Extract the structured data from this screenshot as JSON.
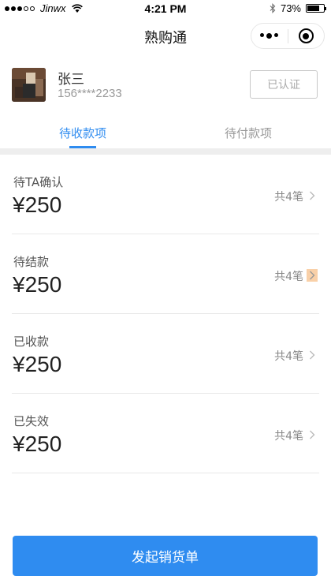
{
  "status_bar": {
    "carrier": "Jinwx",
    "time": "4:21 PM",
    "battery": "73%",
    "battery_level": 0.73
  },
  "nav": {
    "title": "熟购通"
  },
  "profile": {
    "name": "张三",
    "phone": "156****2233",
    "verified_label": "已认证"
  },
  "tabs": [
    {
      "label": "待收款项",
      "active": true
    },
    {
      "label": "待付款项",
      "active": false
    }
  ],
  "items": [
    {
      "label": "待TA确认",
      "amount": "¥250",
      "count": "共4笔",
      "icon": "chevron-right-icon"
    },
    {
      "label": "待结款",
      "amount": "¥250",
      "count": "共4笔",
      "icon": "chevron-right-icon"
    },
    {
      "label": "已收款",
      "amount": "¥250",
      "count": "共4笔",
      "icon": "chevron-right-icon"
    },
    {
      "label": "已失效",
      "amount": "¥250",
      "count": "共4笔",
      "icon": "chevron-right-icon"
    }
  ],
  "primary_button": {
    "label": "发起销货单"
  },
  "colors": {
    "accent": "#2f8cf0",
    "divider": "#eeeeee",
    "muted_text": "#999999"
  }
}
